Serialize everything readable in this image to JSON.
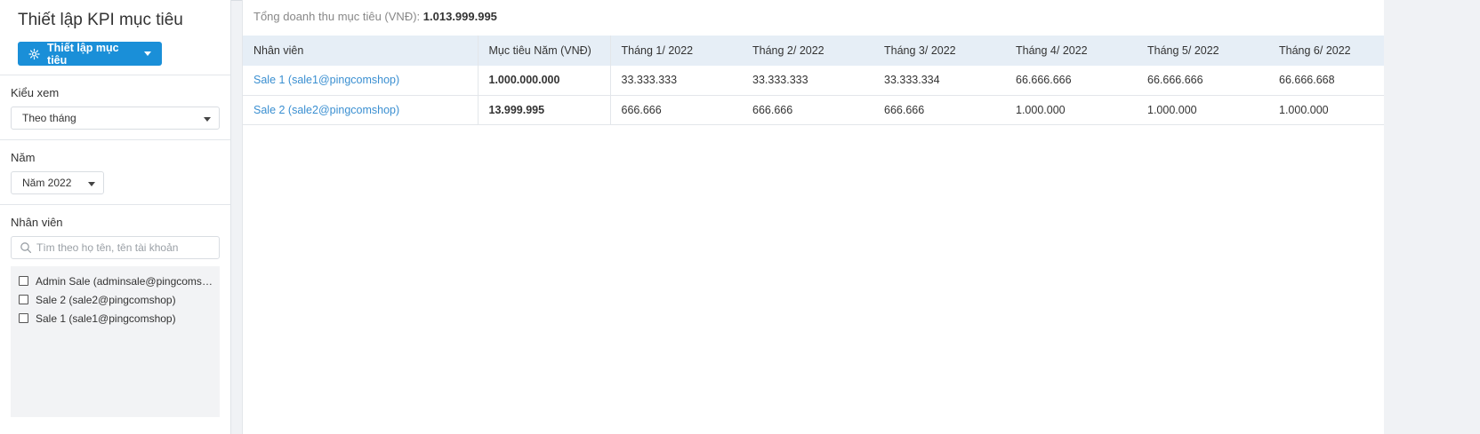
{
  "sidebar": {
    "title": "Thiết lập KPI mục tiêu",
    "setup_button": "Thiết lập mục tiêu",
    "view_mode": {
      "label": "Kiểu xem",
      "value": "Theo tháng"
    },
    "year": {
      "label": "Năm",
      "value": "Năm 2022"
    },
    "employees": {
      "label": "Nhân viên",
      "search_placeholder": "Tìm theo họ tên, tên tài khoản",
      "items": [
        "Admin Sale (adminsale@pingcomshop)",
        "Sale 2 (sale2@pingcomshop)",
        "Sale 1 (sale1@pingcomshop)"
      ]
    }
  },
  "main": {
    "total_label": "Tổng doanh thu mục tiêu (VNĐ):",
    "total_value": "1.013.999.995",
    "table": {
      "headers": [
        "Nhân viên",
        "Mục tiêu Năm (VNĐ)",
        "Tháng 1/ 2022",
        "Tháng 2/ 2022",
        "Tháng 3/ 2022",
        "Tháng 4/ 2022",
        "Tháng 5/ 2022",
        "Tháng 6/ 2022"
      ],
      "rows": [
        [
          "Sale 1 (sale1@pingcomshop)",
          "1.000.000.000",
          "33.333.333",
          "33.333.333",
          "33.333.334",
          "66.666.666",
          "66.666.666",
          "66.666.668"
        ],
        [
          "Sale 2 (sale2@pingcomshop)",
          "13.999.995",
          "666.666",
          "666.666",
          "666.666",
          "1.000.000",
          "1.000.000",
          "1.000.000"
        ]
      ]
    }
  },
  "icons": {
    "setup": "gear-icon",
    "setup_caret": "caret-down-icon",
    "search": "search-icon",
    "select_caret": "caret-down-icon"
  },
  "colors": {
    "primary": "#1a8fd8",
    "link": "#3a8fd1",
    "header_bg": "#e6eef6"
  }
}
